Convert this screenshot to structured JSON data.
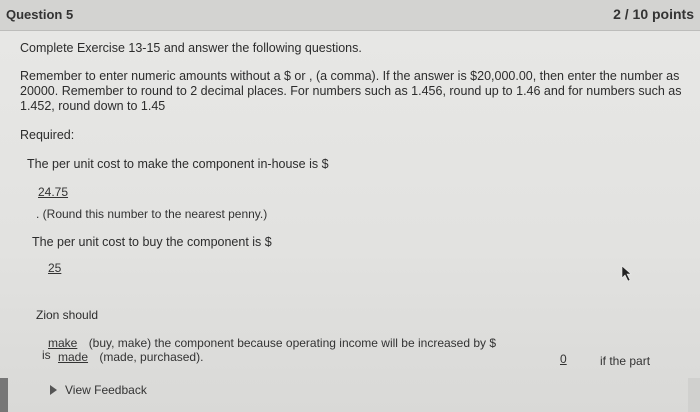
{
  "question": {
    "title": "Question 5",
    "points": "2 / 10 points"
  },
  "instructions": {
    "line1": "Complete Exercise 13-15 and answer the following questions.",
    "line2": "Remember to enter numeric amounts without a $ or , (a comma). If the answer is $20,000.00, then enter the number as 20000. Remember to round to 2 decimal places. For numbers such as 1.456, round up to 1.46 and for numbers such as 1.452, round down to 1.45",
    "required": "Required:"
  },
  "unit_cost_make": {
    "prompt": "The per unit cost to make the component in-house is $",
    "answer": "24.75",
    "note": ". (Round this number to the nearest penny.)"
  },
  "unit_cost_buy": {
    "prompt": "The per unit cost to buy the component is $",
    "answer": "25"
  },
  "decision": {
    "lead": "Zion should",
    "answer_make": "make",
    "text1": "(buy, make) the component because operating income will be increased by $",
    "is_label": "is",
    "answer_made": "made",
    "text2": "(made, purchased).",
    "answer_amount": "0",
    "text3": "if the part"
  },
  "feedback": {
    "label": "View Feedback"
  }
}
